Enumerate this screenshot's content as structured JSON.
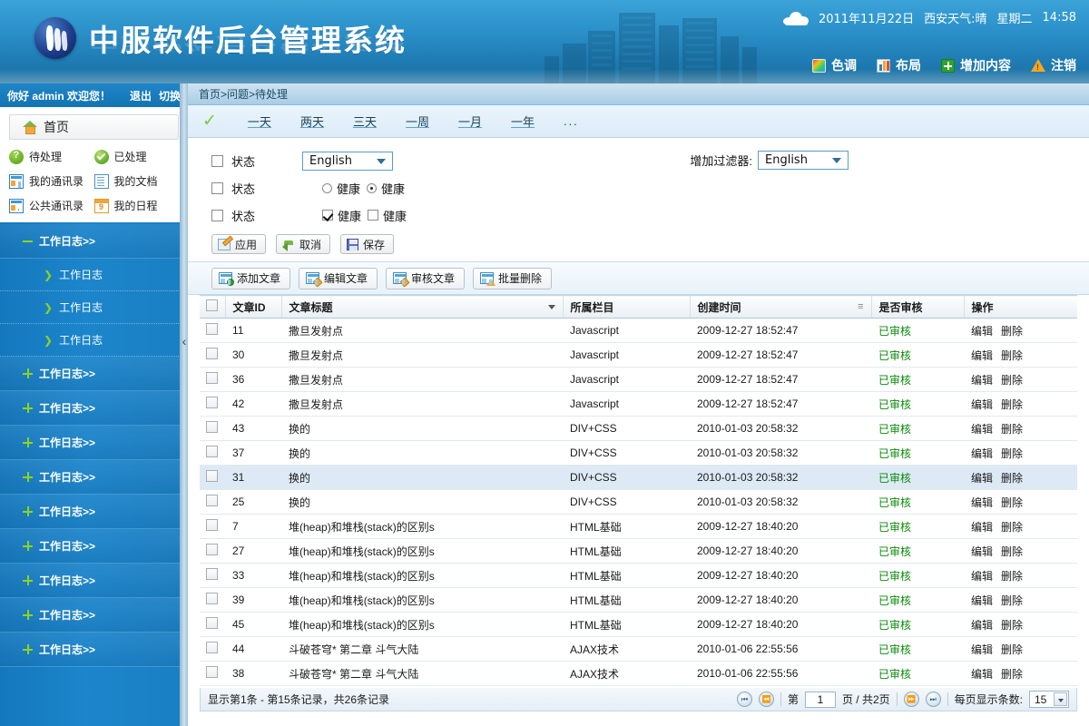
{
  "header": {
    "app_title": "中服软件后台管理系统",
    "logo_icon": "sail-logo-icon",
    "weather_icon": "cloud-icon",
    "date": "2011年11月22日",
    "weather": "西安天气:晴",
    "weekday": "星期二",
    "time": "14:58",
    "menu": [
      {
        "label": "色调",
        "icon": "palette-icon"
      },
      {
        "label": "布局",
        "icon": "bar-chart-icon"
      },
      {
        "label": "增加内容",
        "icon": "plus-square-icon"
      },
      {
        "label": "注销",
        "icon": "warning-triangle-icon"
      }
    ]
  },
  "sidebar": {
    "welcome": "你好 admin 欢迎您！",
    "logout": "退出",
    "switch": "切换",
    "home_label": "首页",
    "home_icon": "home-icon",
    "quick_items": [
      {
        "label": "待处理",
        "icon": "question-circle-icon"
      },
      {
        "label": "已处理",
        "icon": "check-circle-icon"
      },
      {
        "label": "我的通讯录",
        "icon": "contacts-icon"
      },
      {
        "label": "我的文档",
        "icon": "document-icon"
      },
      {
        "label": "公共通讯录",
        "icon": "public-contacts-icon"
      },
      {
        "label": "我的日程",
        "icon": "calendar-icon"
      }
    ],
    "tree": [
      {
        "label": "工作日志>>",
        "type": "node",
        "expanded": true
      },
      {
        "label": "工作日志",
        "type": "leaf"
      },
      {
        "label": "工作日志",
        "type": "leaf"
      },
      {
        "label": "工作日志",
        "type": "leaf"
      },
      {
        "label": "工作日志>>",
        "type": "node",
        "expanded": false
      },
      {
        "label": "工作日志>>",
        "type": "node",
        "expanded": false
      },
      {
        "label": "工作日志>>",
        "type": "node",
        "expanded": false
      },
      {
        "label": "工作日志>>",
        "type": "node",
        "expanded": false
      },
      {
        "label": "工作日志>>",
        "type": "node",
        "expanded": false
      },
      {
        "label": "工作日志>>",
        "type": "node",
        "expanded": false
      },
      {
        "label": "工作日志>>",
        "type": "node",
        "expanded": false
      },
      {
        "label": "工作日志>>",
        "type": "node",
        "expanded": false
      },
      {
        "label": "工作日志>>",
        "type": "node",
        "expanded": false
      }
    ],
    "collapse_icon": "chevron-left-icon"
  },
  "main": {
    "breadcrumb": "首页>问题>待处理",
    "range_toggle_icon": "chevron-down-icon",
    "ranges": [
      "一天",
      "两天",
      "三天",
      "一周",
      "一月",
      "一年"
    ],
    "ranges_more": "...",
    "filter": {
      "rows": [
        {
          "label": "状态",
          "control": "select",
          "value": "English"
        },
        {
          "label": "状态",
          "control": "radio",
          "options": [
            "健康",
            "健康"
          ],
          "selected": 1
        },
        {
          "label": "状态",
          "control": "checkbox",
          "options": [
            "健康",
            "健康"
          ],
          "checked": [
            true,
            false
          ]
        }
      ],
      "add_filter_label": "增加过滤器:",
      "add_filter_value": "English",
      "buttons": [
        {
          "label": "应用",
          "icon": "apply-icon"
        },
        {
          "label": "取消",
          "icon": "cancel-arrow-icon"
        },
        {
          "label": "保存",
          "icon": "save-disk-icon"
        }
      ]
    },
    "toolbar": [
      {
        "label": "添加文章",
        "icon": "add-article-icon"
      },
      {
        "label": "编辑文章",
        "icon": "edit-article-icon"
      },
      {
        "label": "审核文章",
        "icon": "review-article-icon"
      },
      {
        "label": "批量删除",
        "icon": "batch-delete-icon"
      }
    ],
    "table": {
      "columns": [
        "文章ID",
        "文章标题",
        "所属栏目",
        "创建时间",
        "是否审核",
        "操作"
      ],
      "edit_label": "编辑",
      "delete_label": "删除",
      "rows": [
        {
          "id": "11",
          "title": "撒旦发射点",
          "category": "Javascript",
          "created": "2009-12-27 18:52:47",
          "status": "已审核",
          "highlight": false
        },
        {
          "id": "30",
          "title": "撒旦发射点",
          "category": "Javascript",
          "created": "2009-12-27 18:52:47",
          "status": "已审核",
          "highlight": false
        },
        {
          "id": "36",
          "title": "撒旦发射点",
          "category": "Javascript",
          "created": "2009-12-27 18:52:47",
          "status": "已审核",
          "highlight": false
        },
        {
          "id": "42",
          "title": "撒旦发射点",
          "category": "Javascript",
          "created": "2009-12-27 18:52:47",
          "status": "已审核",
          "highlight": false
        },
        {
          "id": "43",
          "title": "换的",
          "category": "DIV+CSS",
          "created": "2010-01-03 20:58:32",
          "status": "已审核",
          "highlight": false
        },
        {
          "id": "37",
          "title": "换的",
          "category": "DIV+CSS",
          "created": "2010-01-03 20:58:32",
          "status": "已审核",
          "highlight": false
        },
        {
          "id": "31",
          "title": "换的",
          "category": "DIV+CSS",
          "created": "2010-01-03 20:58:32",
          "status": "已审核",
          "highlight": true
        },
        {
          "id": "25",
          "title": "换的",
          "category": "DIV+CSS",
          "created": "2010-01-03 20:58:32",
          "status": "已审核",
          "highlight": false
        },
        {
          "id": "7",
          "title": "堆(heap)和堆栈(stack)的区别s",
          "category": "HTML基础",
          "created": "2009-12-27 18:40:20",
          "status": "已审核",
          "highlight": false
        },
        {
          "id": "27",
          "title": "堆(heap)和堆栈(stack)的区别s",
          "category": "HTML基础",
          "created": "2009-12-27 18:40:20",
          "status": "已审核",
          "highlight": false
        },
        {
          "id": "33",
          "title": "堆(heap)和堆栈(stack)的区别s",
          "category": "HTML基础",
          "created": "2009-12-27 18:40:20",
          "status": "已审核",
          "highlight": false
        },
        {
          "id": "39",
          "title": "堆(heap)和堆栈(stack)的区别s",
          "category": "HTML基础",
          "created": "2009-12-27 18:40:20",
          "status": "已审核",
          "highlight": false
        },
        {
          "id": "45",
          "title": "堆(heap)和堆栈(stack)的区别s",
          "category": "HTML基础",
          "created": "2009-12-27 18:40:20",
          "status": "已审核",
          "highlight": false
        },
        {
          "id": "44",
          "title": "斗破苍穹* 第二章 斗气大陆",
          "category": "AJAX技术",
          "created": "2010-01-06 22:55:56",
          "status": "已审核",
          "highlight": false
        },
        {
          "id": "38",
          "title": "斗破苍穹* 第二章 斗气大陆",
          "category": "AJAX技术",
          "created": "2010-01-06 22:55:56",
          "status": "已审核",
          "highlight": false
        }
      ]
    },
    "pager": {
      "info": "显示第1条 - 第15条记录，共26条记录",
      "page_prefix": "第",
      "page_value": "1",
      "page_suffix": "页 / 共2页",
      "page_size_label": "每页显示条数:",
      "page_size": "15",
      "first_icon": "first-page-icon",
      "prev_icon": "prev-page-icon",
      "next_icon": "next-page-icon",
      "last_icon": "last-page-icon"
    }
  },
  "colors": {
    "header_blue": "#2e94cd",
    "sidebar_blue": "#1a7fc3",
    "accent_green": "#8fd41f",
    "status_green": "#0a8a0a",
    "breadcrumb_blue": "#a9cde4"
  }
}
